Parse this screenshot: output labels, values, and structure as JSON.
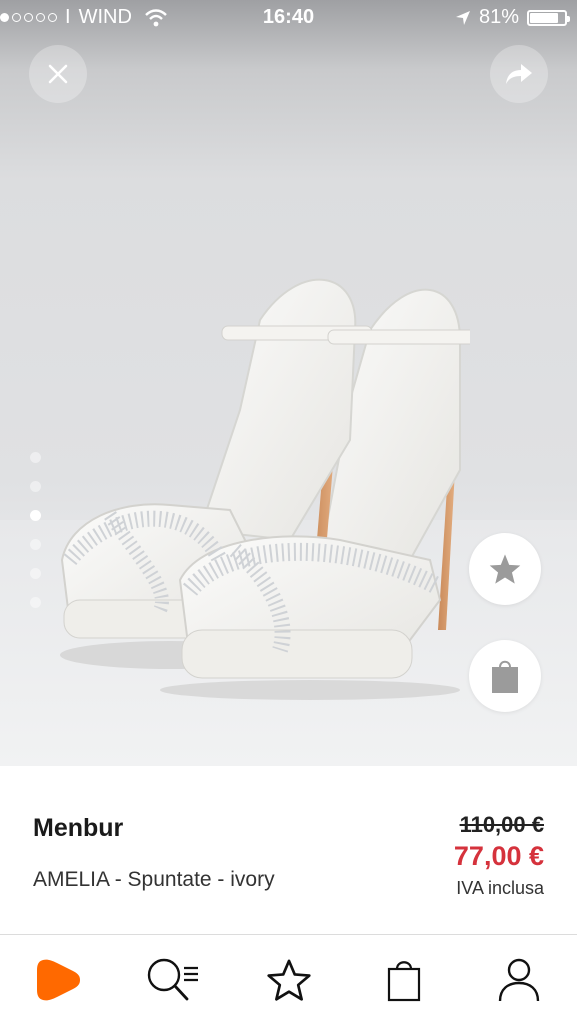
{
  "status_bar": {
    "carrier": "WIND",
    "time": "16:40",
    "battery_text": "81%",
    "battery_level": 0.81,
    "signal_dots_filled": 1,
    "signal_dots_total": 5
  },
  "gallery": {
    "image_count": 6,
    "active_index": 2,
    "image_alt": "white satin platform sandals with crystal straps"
  },
  "product": {
    "brand": "Menbur",
    "name": "AMELIA - Spuntate - ivory",
    "old_price": "110,00 €",
    "price": "77,00 €",
    "vat_note": "IVA inclusa"
  },
  "colors": {
    "accent": "#ff6900",
    "price_red": "#d5323c",
    "icon_gray": "#9b9b9b"
  },
  "tabbar": {
    "items": [
      {
        "icon": "zalando-logo-icon",
        "active": true
      },
      {
        "icon": "search-list-icon",
        "active": false
      },
      {
        "icon": "star-icon",
        "active": false
      },
      {
        "icon": "shopping-bag-icon",
        "active": false
      },
      {
        "icon": "user-icon",
        "active": false
      }
    ]
  }
}
